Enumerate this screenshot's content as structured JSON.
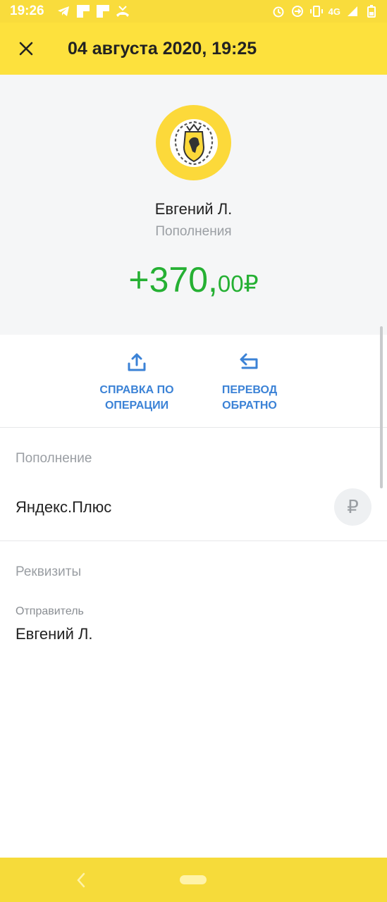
{
  "status_bar": {
    "time": "19:26",
    "network": "4G",
    "left_icons": [
      "telegram-icon",
      "notification-square-icon",
      "notification-square-icon",
      "missed-call-icon"
    ],
    "right_icons": [
      "alarm-icon",
      "sync-icon",
      "vibrate-icon",
      "signal-icon",
      "battery-icon"
    ]
  },
  "header": {
    "title": "04 августа 2020, 19:25",
    "close_icon": "close-icon"
  },
  "summary": {
    "name": "Евгений Л.",
    "category": "Пополнения",
    "amount_int": "+370,",
    "amount_frac": "00₽"
  },
  "actions": [
    {
      "label": "СПРАВКА ПО\nОПЕРАЦИИ",
      "icon": "share-upload-icon"
    },
    {
      "label": "ПЕРЕВОД\nОБРАТНО",
      "icon": "return-arrow-icon"
    }
  ],
  "details": {
    "section1_heading": "Пополнение",
    "section1_value": "Яндекс.Плюс",
    "currency_symbol": "₽",
    "section2_heading": "Реквизиты",
    "sender_label": "Отправитель",
    "sender_value": "Евгений Л."
  },
  "colors": {
    "brand_yellow": "#fde13d",
    "amount_green": "#25b033",
    "action_blue": "#3b82d6"
  }
}
